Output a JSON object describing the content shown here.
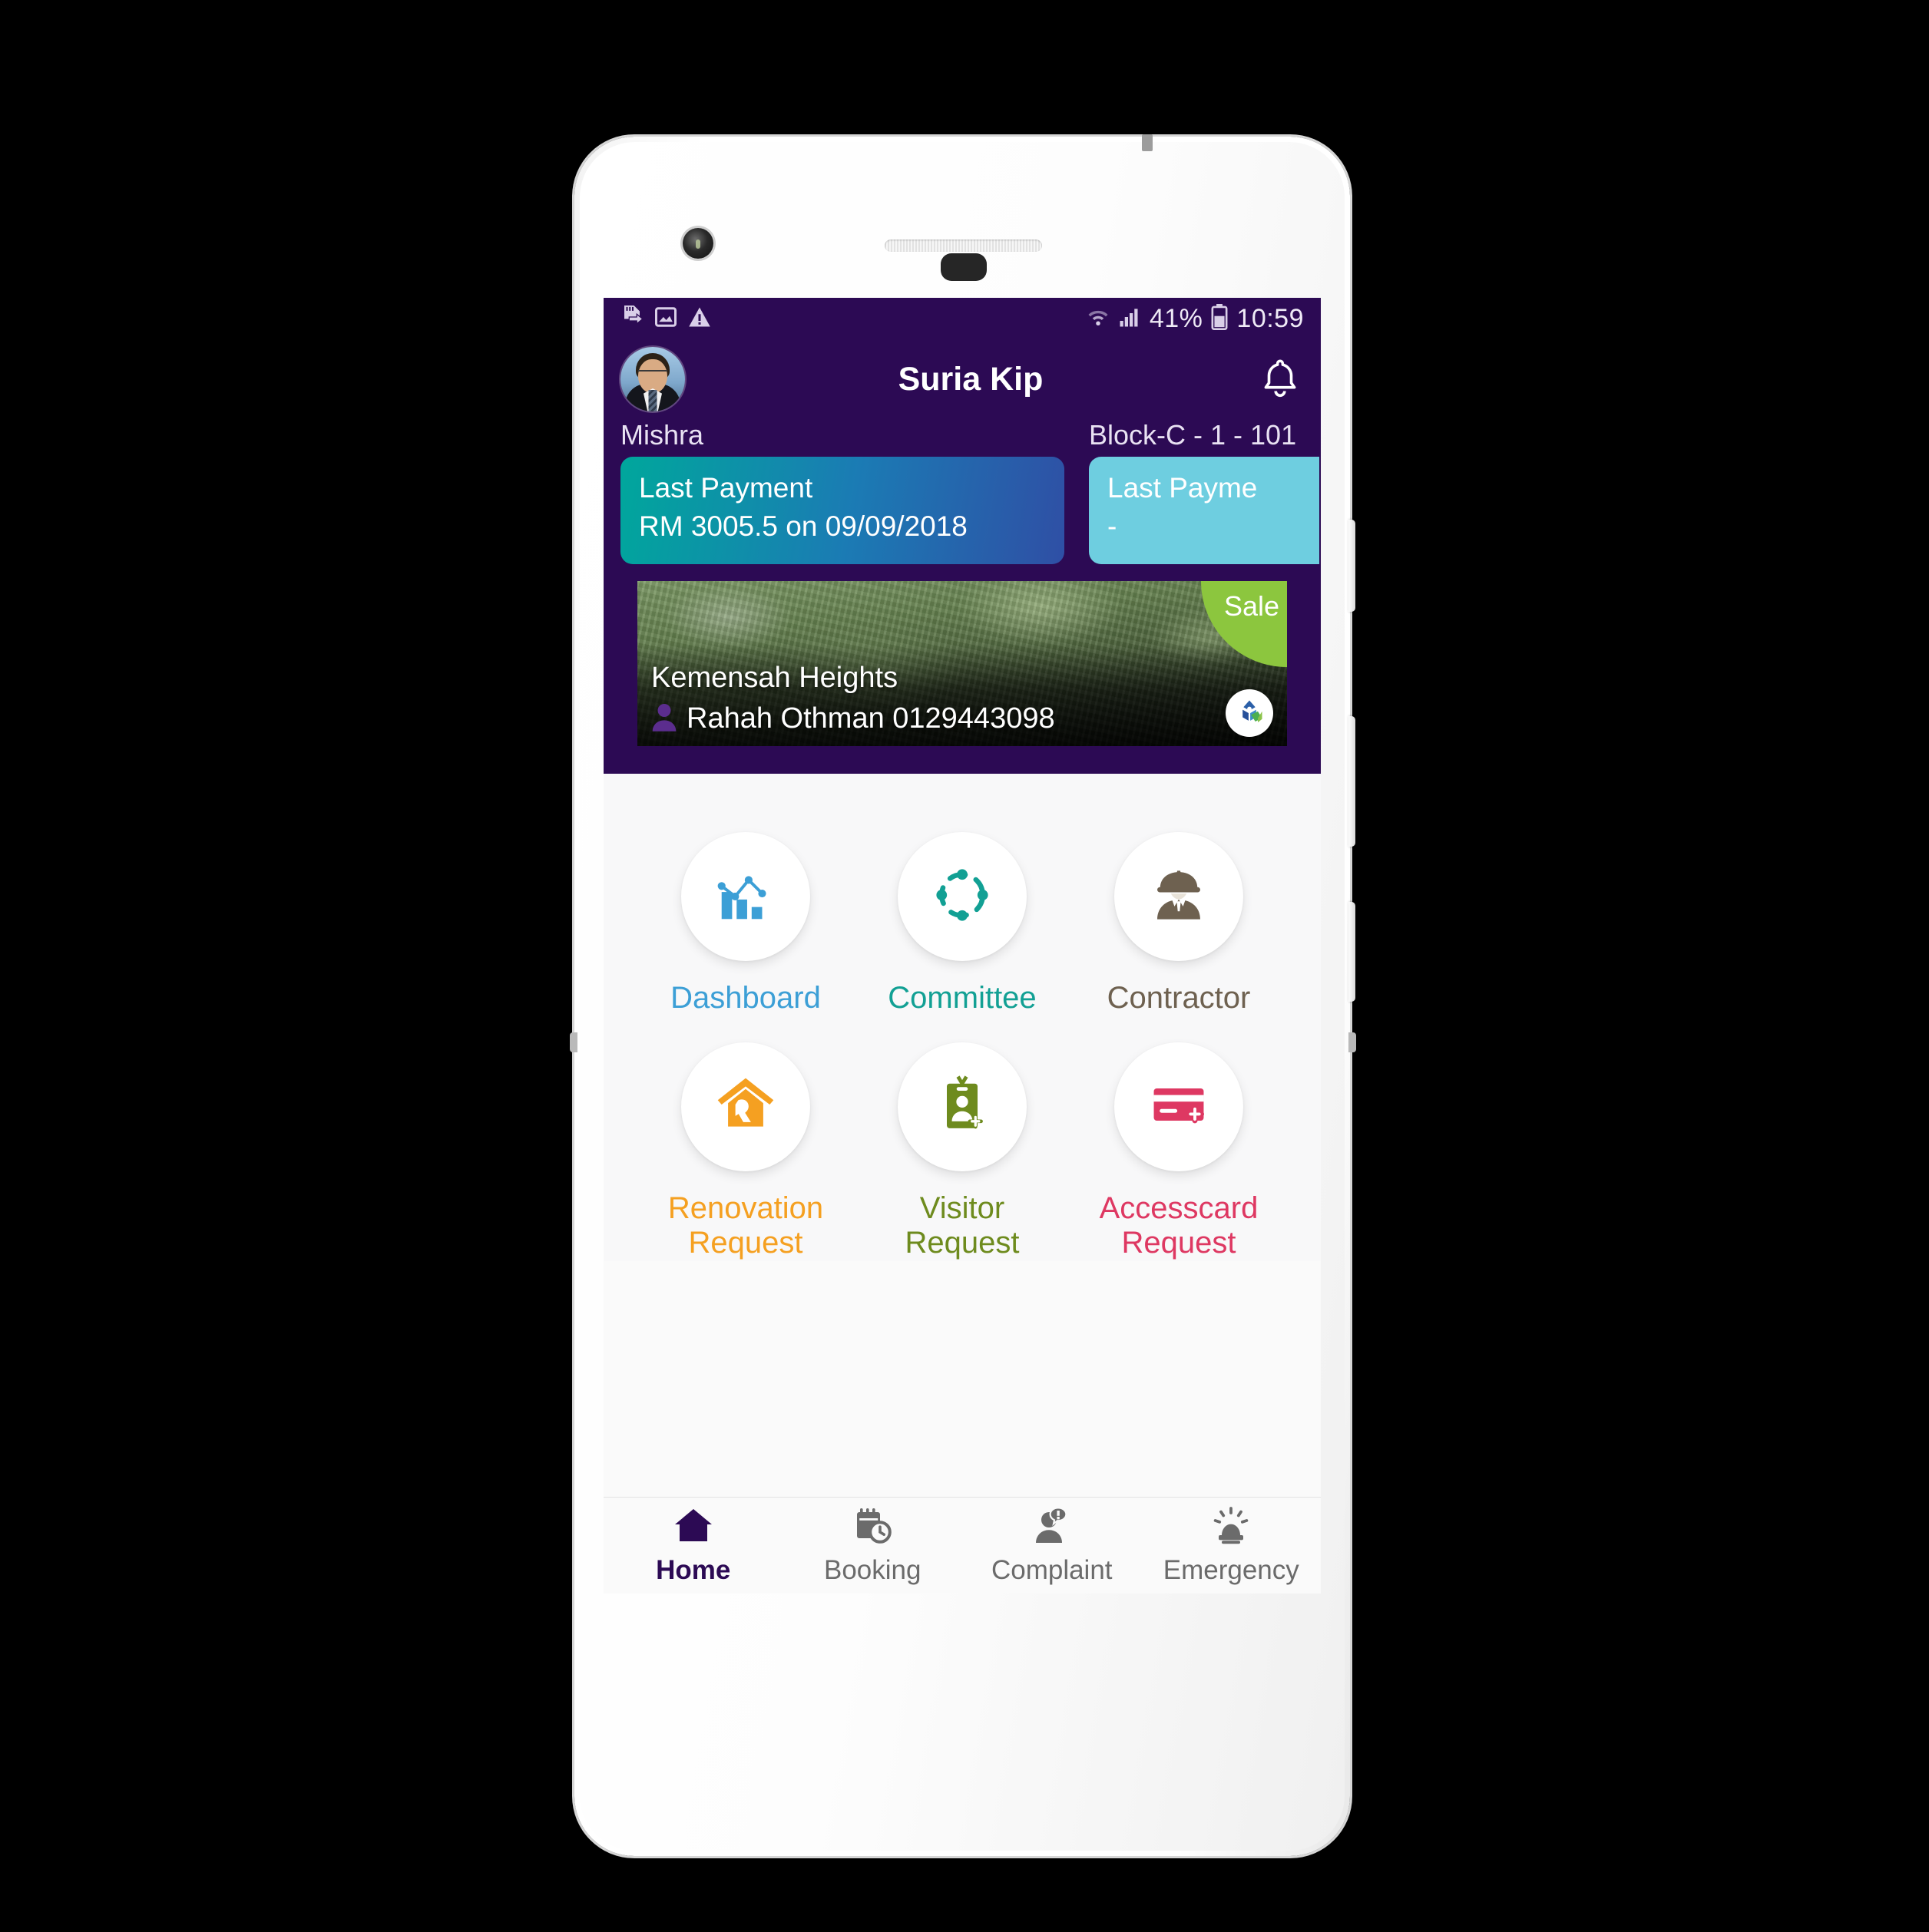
{
  "status_bar": {
    "icons_left": [
      "sd-card-transfer-icon",
      "screenshot-image-icon",
      "warning-triangle-icon"
    ],
    "wifi": "wifi-icon",
    "signal": "cellular-signal-icon",
    "battery_percent": "41%",
    "battery": "battery-icon",
    "time": "10:59"
  },
  "header": {
    "avatar": "user-avatar",
    "title": "Suria Kip",
    "bell": "notification-bell-icon",
    "background_color": "#2C0A54"
  },
  "payment": {
    "primary": {
      "owner_label": "Mishra",
      "card_title": "Last Payment",
      "card_value": "RM 3005.5 on 09/09/2018",
      "gradient_from": "#00A79C",
      "gradient_to": "#2F4FA5"
    },
    "secondary": {
      "unit_label": "Block-C - 1 - 101",
      "card_title": "Last Payme",
      "card_value": "-",
      "color": "#6ECEE0"
    }
  },
  "banner": {
    "badge": "Sale",
    "badge_color": "#8CC63E",
    "property_name": "Kemensah Heights",
    "agent_name": "Rahah Othman 0129443098",
    "agent_icon": "person-icon",
    "logo": "brand-logo-icon"
  },
  "menu": {
    "items": [
      {
        "label": "Dashboard",
        "icon": "bar-chart-icon",
        "color": "#3C9FD6"
      },
      {
        "label": "Committee",
        "icon": "dotted-circle-icon",
        "color": "#12A094"
      },
      {
        "label": "Contractor",
        "icon": "hardhat-worker-icon",
        "color": "#6E6150"
      },
      {
        "label": "Renovation\nRequest",
        "label_line1": "Renovation",
        "label_line2": "Request",
        "icon": "house-hammer-icon",
        "color": "#F5A021"
      },
      {
        "label": "Visitor\nRequest",
        "label_line1": "Visitor",
        "label_line2": "Request",
        "icon": "id-badge-add-icon",
        "color": "#6E8B1E"
      },
      {
        "label": "Accesscard\nRequest",
        "label_line1": "Accesscard",
        "label_line2": "Request",
        "icon": "access-card-add-icon",
        "color": "#DE3862"
      }
    ]
  },
  "bottom_nav": {
    "items": [
      {
        "label": "Home",
        "icon": "home-icon",
        "active": true
      },
      {
        "label": "Booking",
        "icon": "calendar-clock-icon",
        "active": false
      },
      {
        "label": "Complaint",
        "icon": "person-message-icon",
        "active": false
      },
      {
        "label": "Emergency",
        "icon": "siren-alarm-icon",
        "active": false
      }
    ],
    "active_color": "#2C0A54",
    "inactive_color": "#6B6B6B"
  }
}
